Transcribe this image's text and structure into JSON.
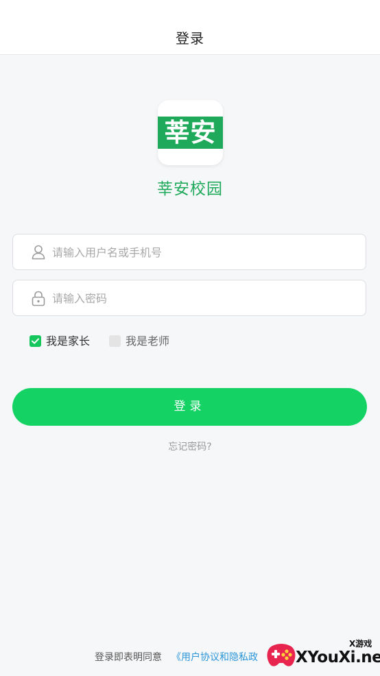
{
  "header": {
    "title": "登录"
  },
  "logo": {
    "text": "莘安"
  },
  "app_name": "莘安校园",
  "form": {
    "username": {
      "placeholder": "请输入用户名或手机号",
      "value": "",
      "icon": "user-icon"
    },
    "password": {
      "placeholder": "请输入密码",
      "value": "",
      "icon": "lock-icon"
    },
    "roles": [
      {
        "label": "我是家长",
        "checked": true
      },
      {
        "label": "我是老师",
        "checked": false
      }
    ],
    "login_label": "登录",
    "forgot_label": "忘记密码?"
  },
  "footer": {
    "prefix": "登录即表明同意",
    "link": "《用户协议和隐私政"
  },
  "watermark": {
    "small": "X游戏",
    "main": "XYouXi.net"
  },
  "colors": {
    "accent": "#14d263",
    "brand": "#1fa95a",
    "link": "#2a96d8",
    "checkbox_on": "#14c65c",
    "checkbox_off": "#e4e4e4"
  }
}
